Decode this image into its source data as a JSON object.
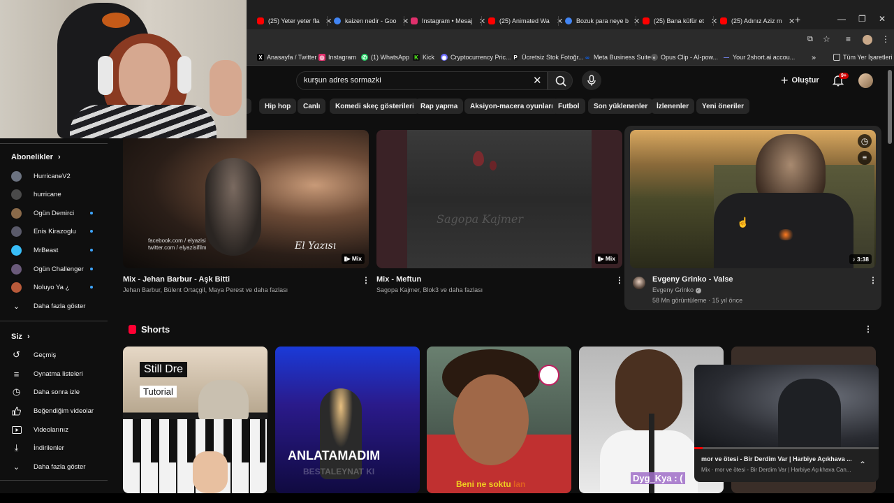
{
  "browser": {
    "tabs": [
      {
        "title": "(25) Yeter yeter fla",
        "favicon": "youtube-icon",
        "color": "#ff0000"
      },
      {
        "title": "kaizen nedir - Goo",
        "favicon": "google-icon",
        "color": "#4285f4"
      },
      {
        "title": "Instagram • Mesaj",
        "favicon": "instagram-icon",
        "color": "#e1306c"
      },
      {
        "title": "(25) Animated Wa",
        "favicon": "youtube-icon",
        "color": "#ff0000"
      },
      {
        "title": "Bozuk para neye b",
        "favicon": "google-icon",
        "color": "#4285f4"
      },
      {
        "title": "(25) Bana küfür et",
        "favicon": "youtube-icon",
        "color": "#ff0000"
      },
      {
        "title": "(25) Adınız Aziz m",
        "favicon": "youtube-icon",
        "color": "#ff0000"
      }
    ],
    "new_tab": "+",
    "bookmarks": [
      {
        "label": "Anasayfa / Twitter",
        "icon": "x-icon",
        "glyph": "X",
        "color": "#000000"
      },
      {
        "label": "Instagram",
        "icon": "instagram-icon",
        "glyph": "◎",
        "color": "#e1306c"
      },
      {
        "label": "(1) WhatsApp",
        "icon": "whatsapp-icon",
        "glyph": "✆",
        "color": "#25d366"
      },
      {
        "label": "Kick",
        "icon": "kick-icon",
        "glyph": "K",
        "color": "#53fc18"
      },
      {
        "label": "Cryptocurrency Pric...",
        "icon": "crypto-icon",
        "glyph": "◉",
        "color": "#6b6bff"
      },
      {
        "label": "Ücretsiz Stok Fotoğr...",
        "icon": "stock-photo-icon",
        "glyph": "P",
        "color": "#222222"
      },
      {
        "label": "Meta Business Suite",
        "icon": "meta-icon",
        "glyph": "∞",
        "color": "#0866ff"
      },
      {
        "label": "Opus Clip - AI-pow...",
        "icon": "opus-icon",
        "glyph": "◐",
        "color": "#555555"
      },
      {
        "label": "Your 2short.ai accou...",
        "icon": "2short-icon",
        "glyph": "—",
        "color": "#7a8cff"
      }
    ],
    "bookmarks_more": "»",
    "all_bookmarks": "Tüm Yer İşaretleri"
  },
  "header": {
    "search_value": "kurşun adres sormazki",
    "create_label": "Oluştur",
    "notif_count": "9+"
  },
  "chips": [
    "Hip hop",
    "Canlı",
    "Komedi skeç gösterileri",
    "Rap yapma",
    "Aksiyon-macera oyunları",
    "Futbol",
    "Son yüklenenler",
    "İzlenenler",
    "Yeni öneriler"
  ],
  "sidebar": {
    "subs_header": "Abonelikler",
    "subs": [
      {
        "name": "HurricaneV2",
        "dot": false,
        "color": "#6b7280"
      },
      {
        "name": "hurricane",
        "dot": false,
        "color": "#4a4a4a"
      },
      {
        "name": "Ogün Demirci",
        "dot": true,
        "color": "#8a6a4a"
      },
      {
        "name": "Enis Kirazoglu",
        "dot": true,
        "color": "#5a5a6a"
      },
      {
        "name": "MrBeast",
        "dot": true,
        "color": "#38bdf8"
      },
      {
        "name": "Ogün Challenger",
        "dot": true,
        "color": "#6a5a7a"
      },
      {
        "name": "Noluyo Ya ¿",
        "dot": true,
        "color": "#b85a3a"
      }
    ],
    "show_more": "Daha fazla göster",
    "you_header": "Siz",
    "you_items": [
      {
        "label": "Geçmiş",
        "icon": "history-icon",
        "glyph": "↺"
      },
      {
        "label": "Oynatma listeleri",
        "icon": "playlists-icon",
        "glyph": "≡"
      },
      {
        "label": "Daha sonra izle",
        "icon": "watch-later-icon",
        "glyph": "◷"
      },
      {
        "label": "Beğendiğim videolar",
        "icon": "like-icon",
        "glyph": "👍"
      },
      {
        "label": "Videolarınız",
        "icon": "your-videos-icon",
        "glyph": "▶"
      },
      {
        "label": "İndirilenler",
        "icon": "downloads-icon",
        "glyph": "⤓"
      }
    ],
    "show_more_2": "Daha fazla göster"
  },
  "videos": [
    {
      "title": "Mix - Jehan Barbur - Aşk Bitti",
      "subtitle": "Jehan Barbur, Bülent Ortaçgil, Maya Perest ve daha fazlası",
      "badge": "Mix",
      "overlay_left": "facebook.com / elyazisi\ntwitter.com / elyazisifilm",
      "overlay_right": "El Yazısı"
    },
    {
      "title": "Mix - Meftun",
      "subtitle": "Sagopa Kajmer, Blok3 ve daha fazlası",
      "badge": "Mix",
      "overlay_text": "Sagopa Kajmer"
    },
    {
      "title": "Evgeny Grinko - Valse",
      "channel": "Evgeny Grinko",
      "stats": "58 Mn görüntüleme · 15 yıl önce",
      "badge": "3:38"
    }
  ],
  "shorts": {
    "header": "Shorts",
    "items": [
      {
        "caption1": "Still Dre",
        "caption2": "Tutorial"
      },
      {
        "caption1": "ANLATAMADIM",
        "caption2": "BESTALEYNAT KI"
      },
      {
        "caption1": "Beni ne soktu",
        "caption2": "lan"
      },
      {
        "caption1": "Dyg_Kya : ("
      }
    ]
  },
  "miniplayer": {
    "title": "mor ve ötesi - Bir Derdim Var | Harbiye Açıkhava ...",
    "subtitle": "Mix · mor ve ötesi - Bir Derdim Var | Harbiye Açıkhava Can..."
  }
}
